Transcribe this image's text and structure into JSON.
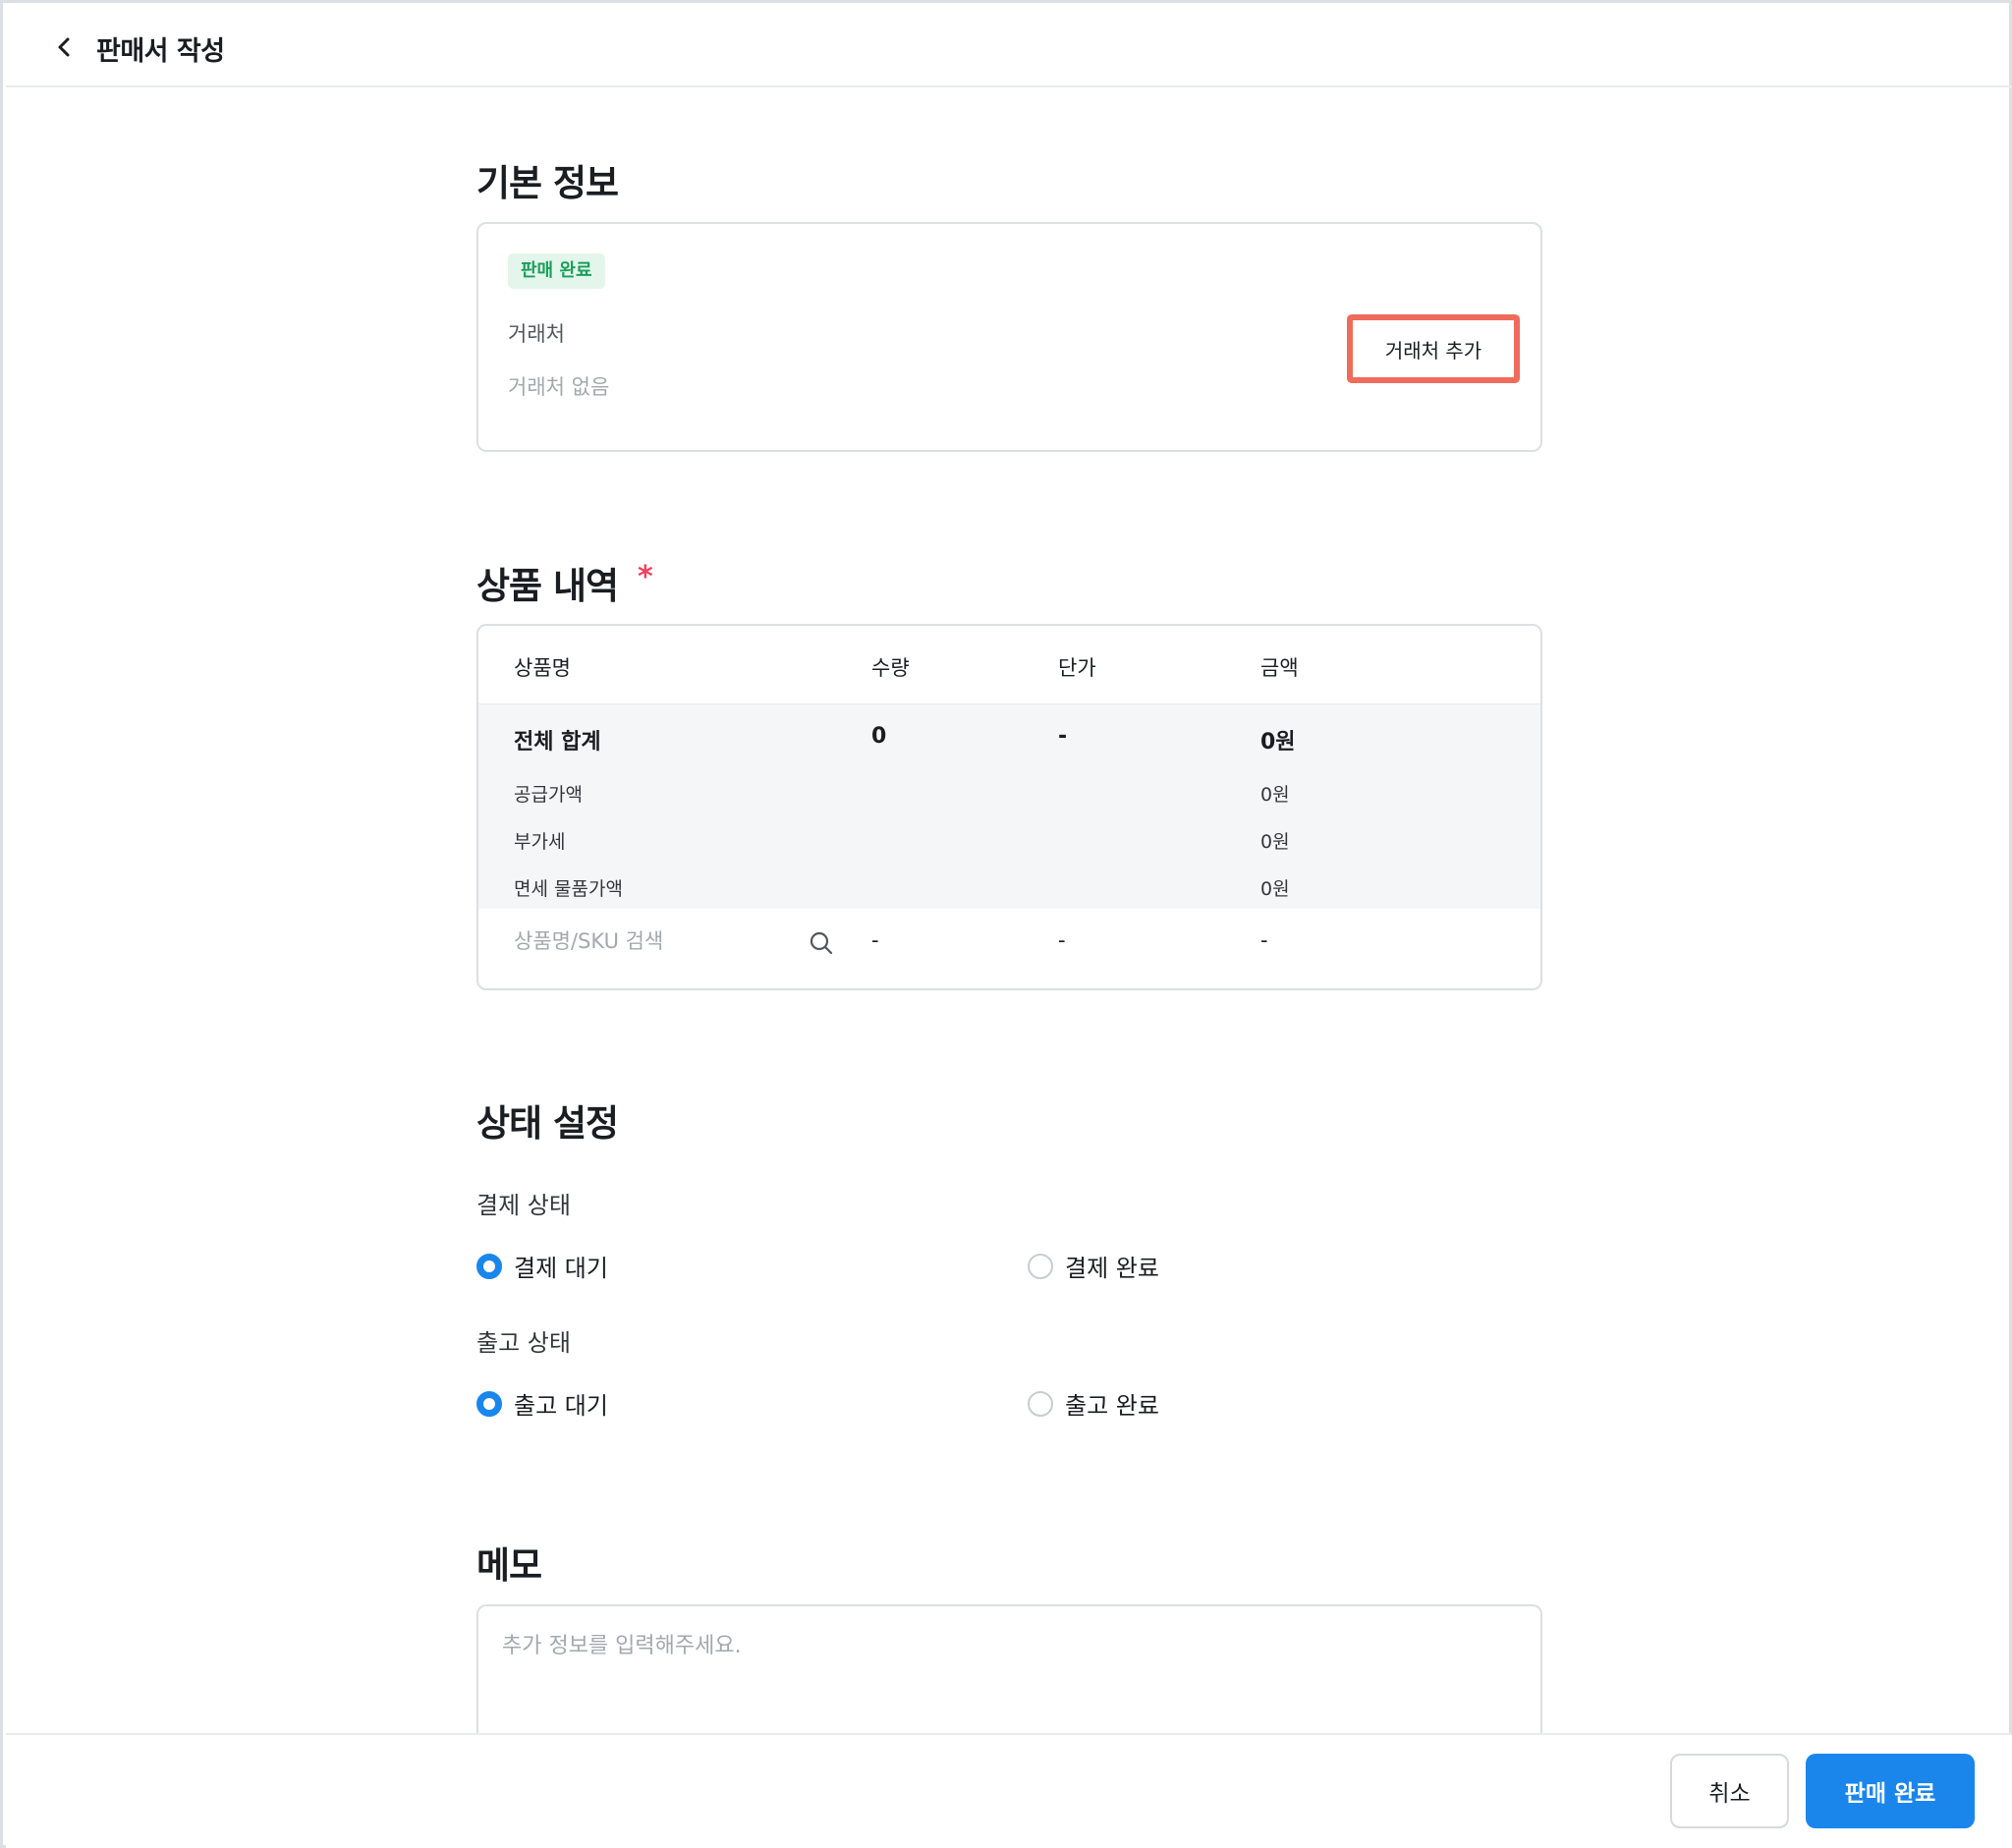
{
  "header": {
    "title": "판매서 작성"
  },
  "basic_info": {
    "title": "기본 정보",
    "badge": "판매 완료",
    "vendor_label": "거래처",
    "vendor_empty": "거래처 없음",
    "add_vendor_label": "거래처 추가"
  },
  "products": {
    "title": "상품 내역",
    "required_mark": "*",
    "columns": [
      "상품명",
      "수량",
      "단가",
      "금액"
    ],
    "total": {
      "label": "전체 합계",
      "qty": "0",
      "price": "-",
      "amount": "0원"
    },
    "breakdown": [
      {
        "label": "공급가액",
        "amount": "0원"
      },
      {
        "label": "부가세",
        "amount": "0원"
      },
      {
        "label": "면세 물품가액",
        "amount": "0원"
      }
    ],
    "search_placeholder": "상품명/SKU 검색",
    "input_row": {
      "qty": "-",
      "price": "-",
      "amount": "-"
    }
  },
  "status": {
    "title": "상태 설정",
    "payment": {
      "label": "결제 상태",
      "options": [
        "결제 대기",
        "결제 완료"
      ],
      "selected": "결제 대기"
    },
    "shipping": {
      "label": "출고 상태",
      "options": [
        "출고 대기",
        "출고 완료"
      ],
      "selected": "출고 대기"
    }
  },
  "memo": {
    "title": "메모",
    "placeholder": "추가 정보를 입력해주세요."
  },
  "footer": {
    "cancel_label": "취소",
    "complete_label": "판매 완료"
  },
  "colors": {
    "primary": "#1a86ec",
    "badge_bg": "#e4f6ec",
    "badge_text": "#1a9e5b",
    "highlight": "#ef6b5b",
    "required": "#f0405e"
  }
}
